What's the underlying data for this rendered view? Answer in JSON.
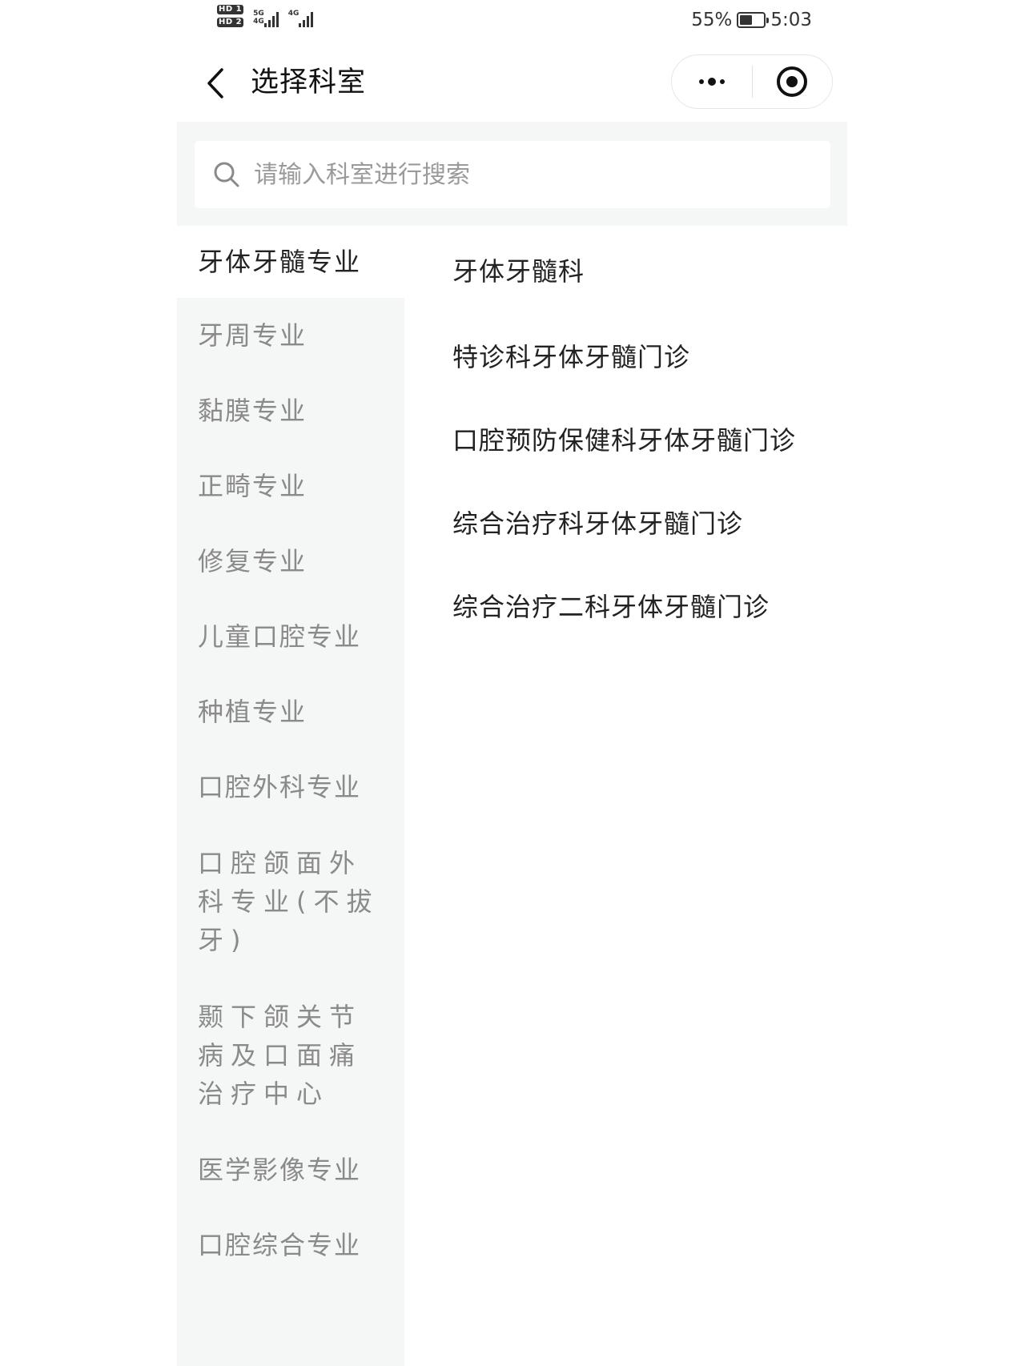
{
  "status_bar": {
    "sim1_badge": "HD 1",
    "sim2_badge": "HD 2",
    "net1_label": "5G",
    "net1_sub": "4G",
    "net2_label": "4G",
    "battery_percent": "55%",
    "battery_level": 0.55,
    "time": "5:03"
  },
  "navbar": {
    "back_icon": "chevron-left-icon",
    "title": "选择科室",
    "more_icon": "more-dots-icon",
    "close_icon": "target-circle-icon"
  },
  "search": {
    "icon": "search-icon",
    "placeholder": "请输入科室进行搜索",
    "value": ""
  },
  "categories": [
    {
      "label": "牙体牙髓专业",
      "active": true
    },
    {
      "label": "牙周专业"
    },
    {
      "label": "黏膜专业"
    },
    {
      "label": "正畸专业"
    },
    {
      "label": "修复专业"
    },
    {
      "label": "儿童口腔专业"
    },
    {
      "label": "种植专业"
    },
    {
      "label": "口腔外科专业"
    },
    {
      "label": "口腔颌面外科专业(不拔牙)"
    },
    {
      "label": "颞下颌关节病及口面痛治疗中心"
    },
    {
      "label": "医学影像专业"
    },
    {
      "label": "口腔综合专业"
    }
  ],
  "departments": [
    {
      "label": "牙体牙髓科"
    },
    {
      "label": "特诊科牙体牙髓门诊"
    },
    {
      "label": "口腔预防保健科牙体牙髓门诊"
    },
    {
      "label": "综合治疗科牙体牙髓门诊"
    },
    {
      "label": "综合治疗二科牙体牙髓门诊"
    }
  ]
}
